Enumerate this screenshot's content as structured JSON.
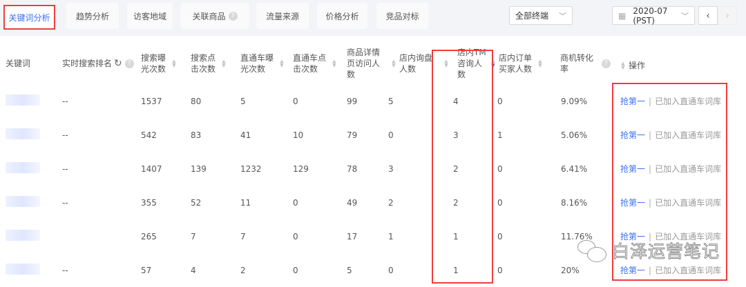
{
  "tabs": [
    {
      "label": "关键词分析",
      "active": true
    },
    {
      "label": "趋势分析"
    },
    {
      "label": "访客地域"
    },
    {
      "label": "关联商品",
      "help": true
    },
    {
      "label": "流量来源"
    },
    {
      "label": "价格分析"
    },
    {
      "label": "竞品对标"
    }
  ],
  "filters": {
    "terminal": "全部终端",
    "date": "2020-07 (PST)"
  },
  "table": {
    "headers": [
      "关键词",
      "实时搜索排名",
      "搜索曝光次数",
      "搜索点击次数",
      "直通车曝光次数",
      "直通车点击次数",
      "商品详情页访问人数",
      "店内询盘人数",
      "店内TM咨询人数",
      "店内订单买家人数",
      "商机转化率",
      "操作"
    ],
    "rows": [
      [
        "",
        "--",
        "1537",
        "80",
        "5",
        "0",
        "99",
        "5",
        "4",
        "0",
        "9.09%"
      ],
      [
        "",
        "--",
        "542",
        "83",
        "41",
        "10",
        "79",
        "0",
        "3",
        "1",
        "5.06%"
      ],
      [
        "",
        "--",
        "1407",
        "139",
        "1232",
        "129",
        "78",
        "3",
        "2",
        "0",
        "6.41%"
      ],
      [
        "",
        "--",
        "355",
        "52",
        "11",
        "0",
        "49",
        "2",
        "2",
        "0",
        "8.16%"
      ],
      [
        "",
        "",
        "265",
        "7",
        "7",
        "0",
        "17",
        "1",
        "1",
        "0",
        "11.76%"
      ],
      [
        "",
        "--",
        "57",
        "4",
        "2",
        "0",
        "5",
        "0",
        "1",
        "0",
        "20%"
      ]
    ],
    "op_link": "抢第一",
    "op_status": "已加入直通车词库"
  },
  "watermark": "白泽运营笔记",
  "colors": {
    "accent": "#3a6ff7",
    "highlight": "#f03c3c"
  }
}
